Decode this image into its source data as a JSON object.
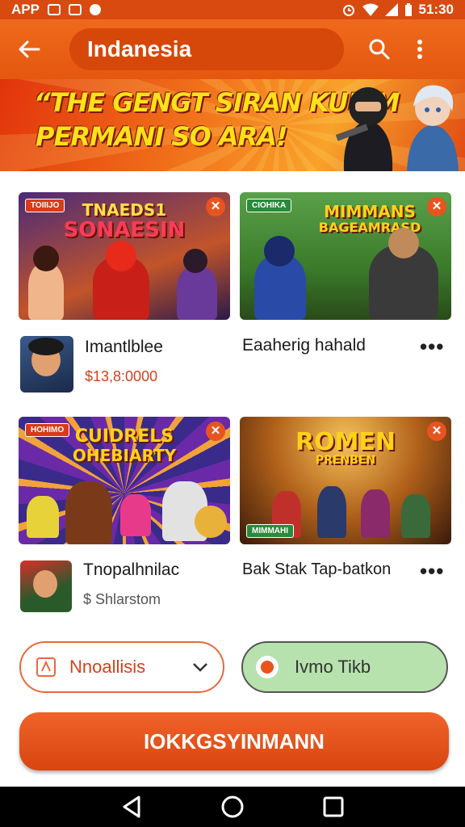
{
  "status_bar": {
    "carrier": "APP",
    "time": "51:30"
  },
  "app_bar": {
    "title": "Indanesia"
  },
  "banner": {
    "line1": "“THE GENGT SIRAN KUIIIM",
    "line2": "PERMANI SO ARA!"
  },
  "cards": [
    {
      "tag": "TOIIIJO",
      "title1": "TNAEDS1",
      "title2": "SONAESIN",
      "bg": "#6a3a8a"
    },
    {
      "tag": "CIOHIKA",
      "title1": "MIMMANS",
      "title2": "BAGEAMRASD",
      "bg": "#3f7a3a"
    },
    {
      "tag": "HOHIMO",
      "title1": "CUIDRELS",
      "title2": "OHEBIARTY",
      "bg": "#3b2a7a"
    },
    {
      "tag": "",
      "title1": "ROMEN",
      "title2": "PRENBEN",
      "bottom_tag": "MIMMAHI",
      "bg": "#5a3412"
    }
  ],
  "items": [
    {
      "name": "Imantlblee",
      "price": "$13,8:0000"
    },
    {
      "name": "Eaaherig hahald"
    },
    {
      "name": "Tnopalhnilac",
      "price": "$ Shlarstom"
    },
    {
      "name": "Bak Stak Tap-batkon"
    }
  ],
  "more_glyph": "•••",
  "filters": {
    "select_label": "Nnoallisis",
    "toggle_label": "Ivmo Tikb"
  },
  "cta_label": "IOKKGSYINMANN",
  "colors": {
    "accent": "#e4570f",
    "price": "#d2421a",
    "green_pill": "#b7e2ad"
  },
  "icons": [
    "back-arrow-icon",
    "search-icon",
    "more-vert-icon",
    "close-icon",
    "chevron-down-icon",
    "nav-back-icon",
    "nav-home-icon",
    "nav-recents-icon"
  ]
}
